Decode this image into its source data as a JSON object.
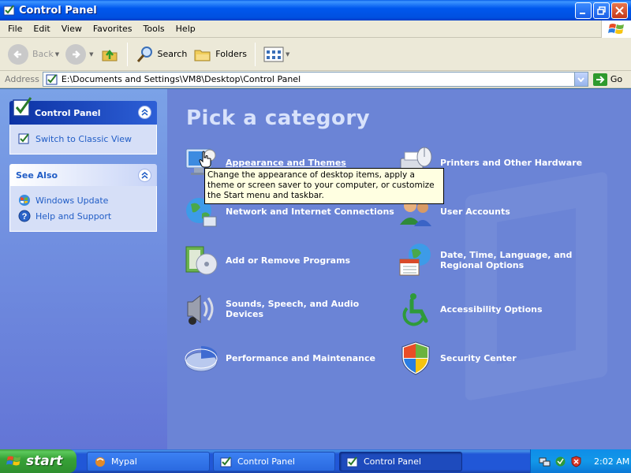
{
  "window": {
    "title": "Control Panel"
  },
  "menu": [
    "File",
    "Edit",
    "View",
    "Favorites",
    "Tools",
    "Help"
  ],
  "toolbar": {
    "back": "Back",
    "search": "Search",
    "folders": "Folders"
  },
  "address": {
    "label": "Address",
    "value": "E:\\Documents and Settings\\VM8\\Desktop\\Control Panel",
    "go": "Go"
  },
  "sidebar": {
    "control_panel": {
      "title": "Control Panel",
      "links": [
        "Switch to Classic View"
      ]
    },
    "see_also": {
      "title": "See Also",
      "links": [
        "Windows Update",
        "Help and Support"
      ]
    }
  },
  "main": {
    "heading": "Pick a category",
    "categories": [
      "Appearance and Themes",
      "Printers and Other Hardware",
      "Network and Internet Connections",
      "User Accounts",
      "Add or Remove Programs",
      "Date, Time, Language, and Regional Options",
      "Sounds, Speech, and Audio Devices",
      "Accessibility Options",
      "Performance and Maintenance",
      "Security Center"
    ],
    "tooltip": "Change the appearance of desktop items, apply a theme or screen saver to your computer, or customize the Start menu and taskbar."
  },
  "taskbar": {
    "start": "start",
    "tasks": [
      "Mypal",
      "Control Panel",
      "Control Panel"
    ],
    "clock": "2:02 AM"
  }
}
